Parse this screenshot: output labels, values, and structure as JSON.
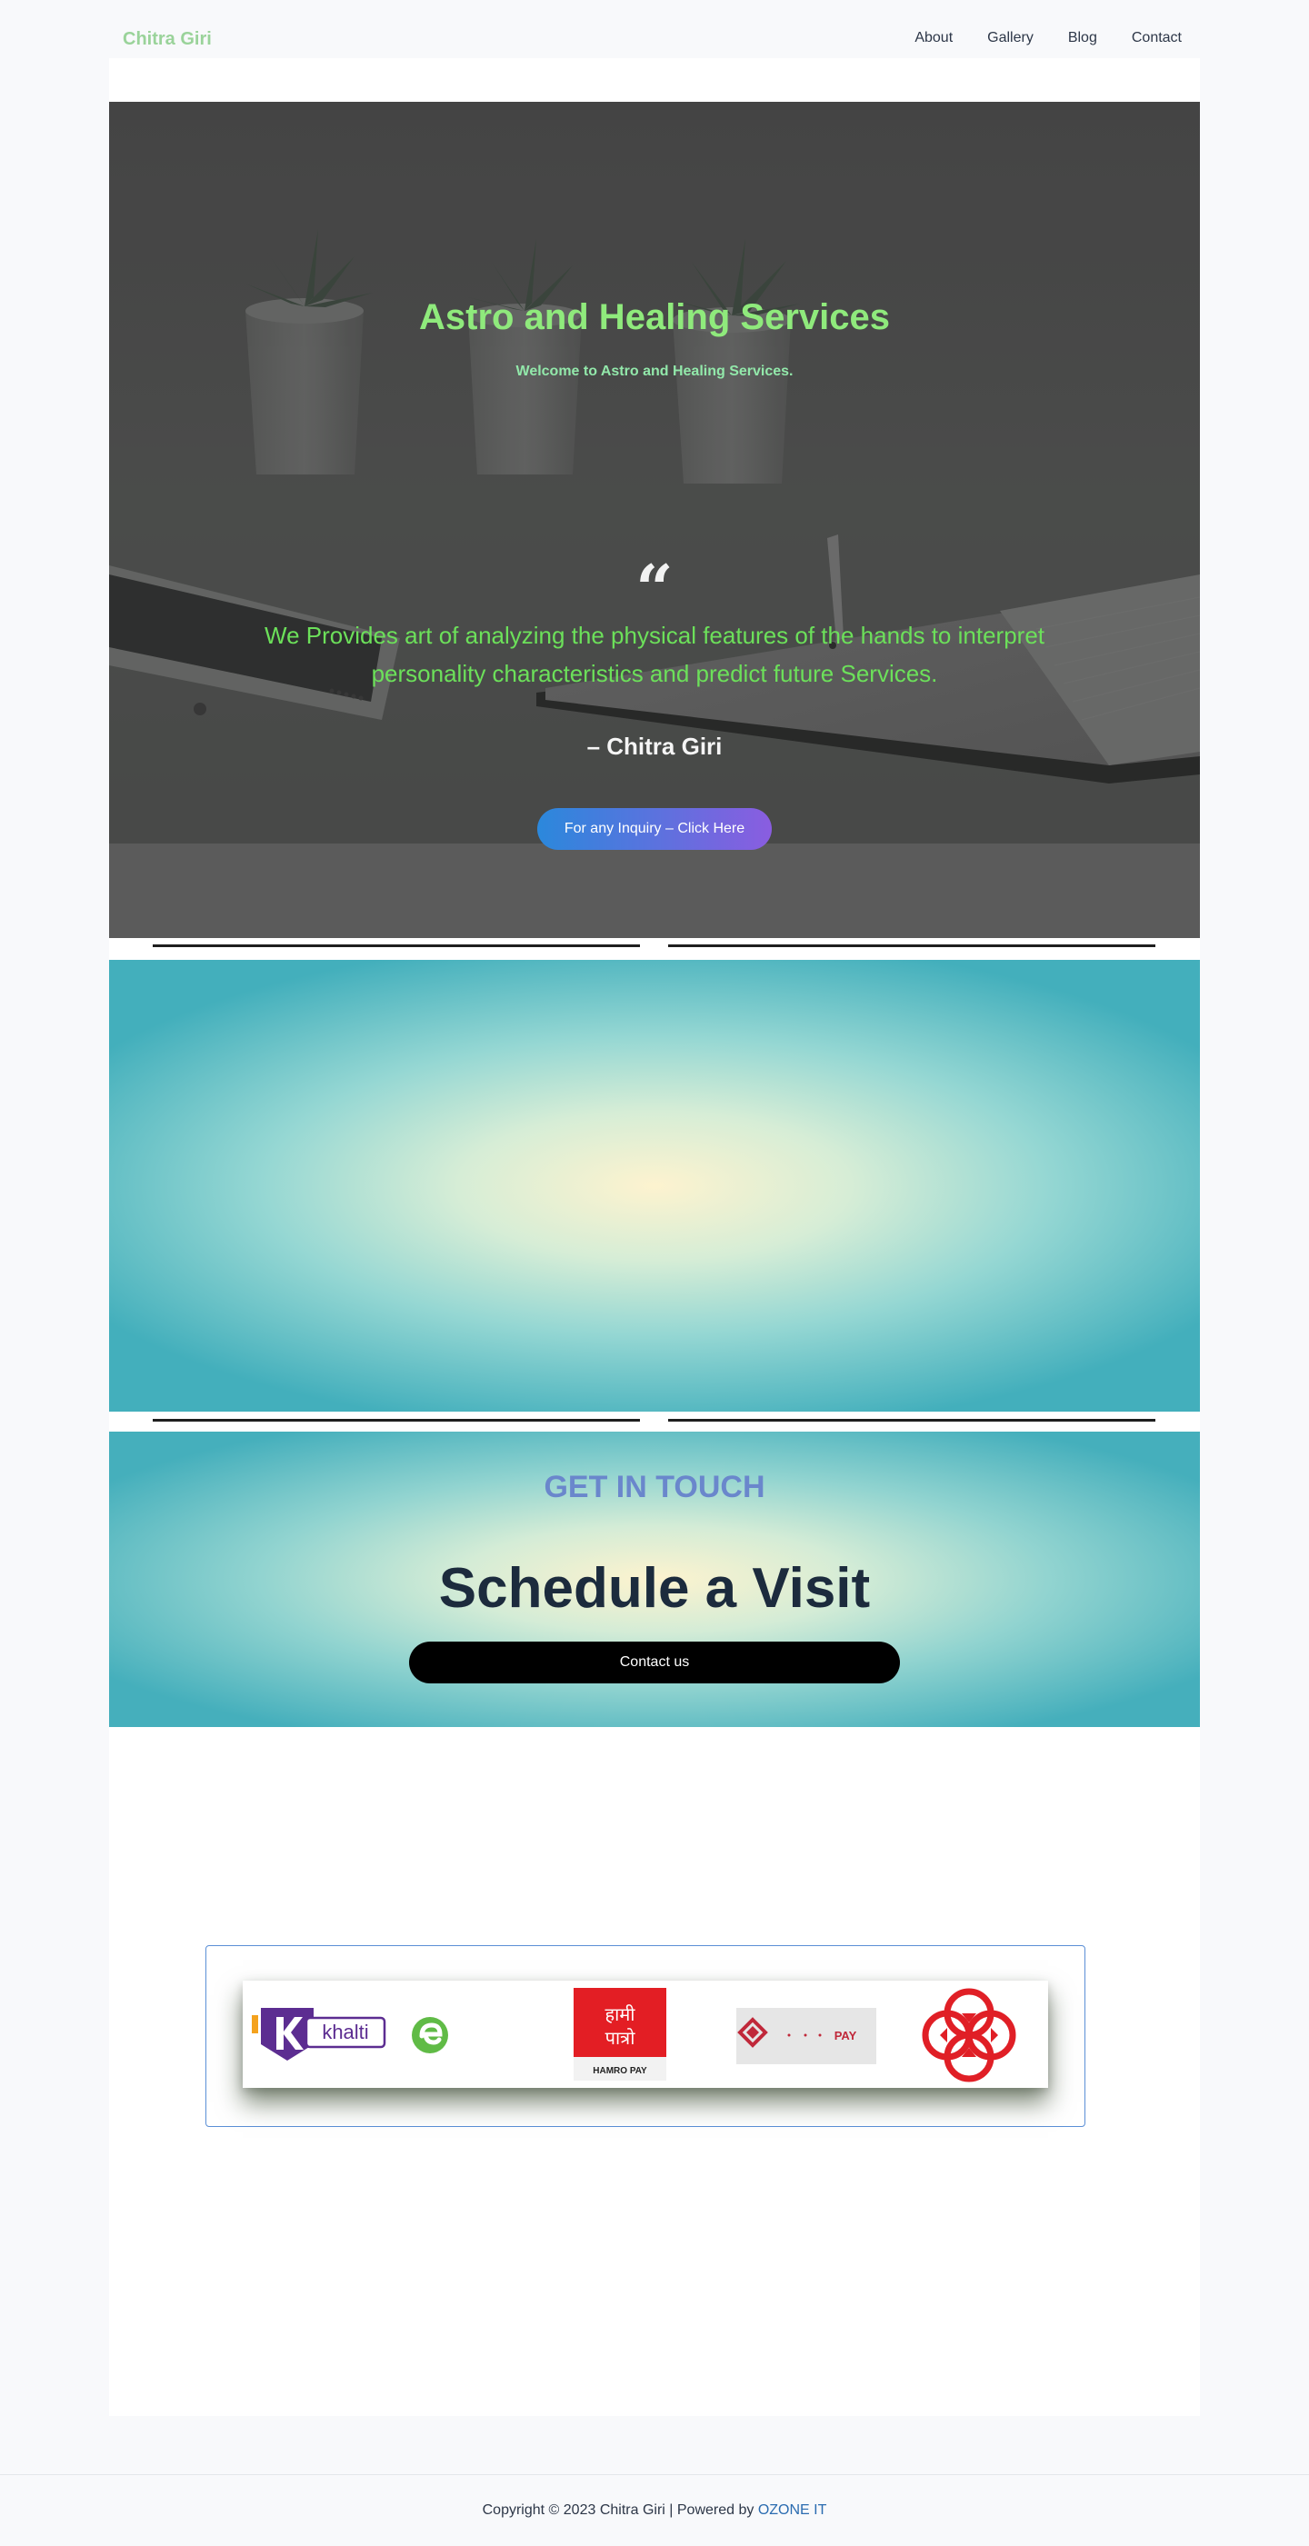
{
  "header": {
    "brand": "Chitra Giri",
    "nav": [
      "About",
      "Gallery",
      "Blog",
      "Contact"
    ]
  },
  "hero": {
    "title": "Astro and Healing Services",
    "subtitle": "Welcome to Astro and Healing Services.",
    "quote_mark": "“",
    "quote": "We Provides art of analyzing the physical features of the hands to interpret personality characteristics and predict future Services.",
    "author": "– Chitra Giri",
    "cta_label": "For any Inquiry – Click Here"
  },
  "get_in_touch": {
    "eyebrow": "GET IN TOUCH",
    "title": "Schedule a Visit",
    "button_label": "Contact us"
  },
  "payments": {
    "logos": [
      "khalti-logo",
      "esewa-logo",
      "hamro-pay-logo",
      "ime-pay-logo",
      "connect-ips-logo"
    ],
    "khalti_text": "khalti",
    "hamro_text": "HAMRO PAY",
    "hamro_devanagari_1": "हामी",
    "hamro_devanagari_2": "पात्रो",
    "pay_text": "PAY"
  },
  "footer": {
    "copyright": "Copyright © 2023 Chitra Giri | Powered by ",
    "link_label": "OZONE IT"
  },
  "colors": {
    "brand": "#9ad39a",
    "hero_title": "#8fea7c",
    "quote_text": "#6ce05a",
    "get_in_touch": "#6a87cc",
    "link": "#2b6cb0"
  }
}
